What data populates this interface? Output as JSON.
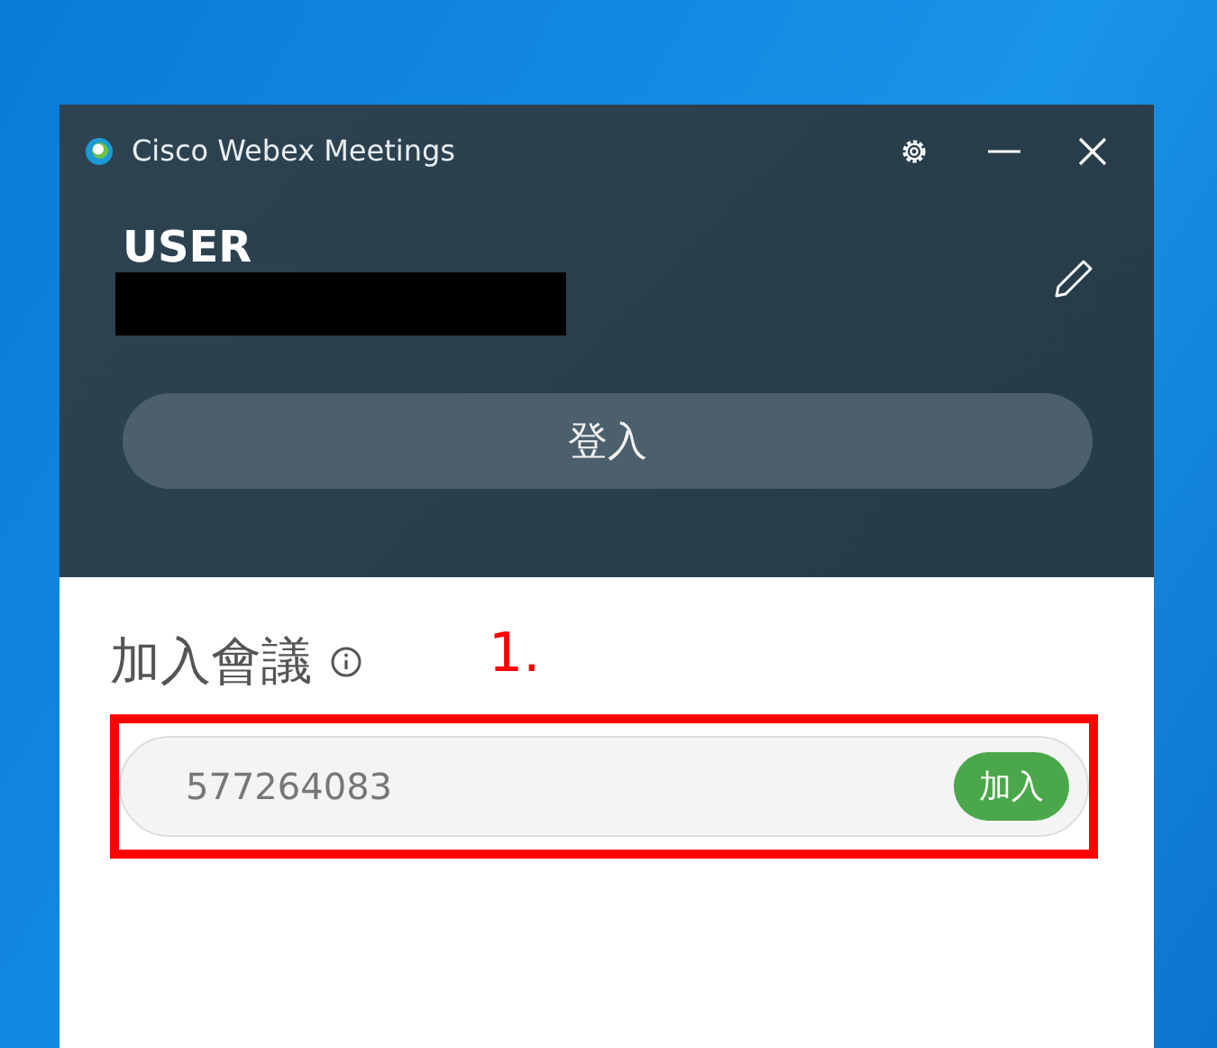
{
  "window": {
    "title": "Cisco Webex Meetings"
  },
  "account": {
    "name": "USER",
    "sign_in_button": "登入"
  },
  "join": {
    "heading": "加入會議",
    "value": "577264083",
    "button": "加入"
  },
  "annotation": {
    "label": "1."
  }
}
